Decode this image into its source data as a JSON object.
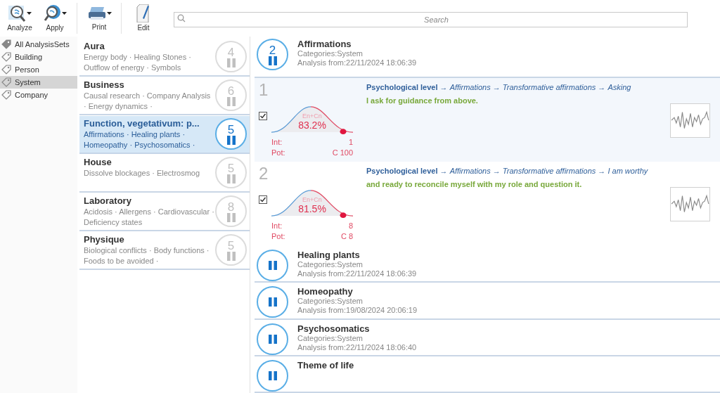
{
  "toolbar": {
    "buttons": [
      {
        "kind": "analyze",
        "label": "Analyze",
        "has_menu": true
      },
      {
        "kind": "apply",
        "label": "Apply",
        "has_menu": true
      },
      {
        "kind": "print",
        "label": "Print",
        "has_menu": true
      },
      {
        "kind": "edit",
        "label": "Edit",
        "has_menu": false
      }
    ]
  },
  "search": {
    "placeholder": "Search"
  },
  "sidebar": {
    "items": [
      {
        "kind": "all",
        "label": "All AnalysisSets",
        "selected": false
      },
      {
        "kind": "tag",
        "label": "Building",
        "selected": false
      },
      {
        "kind": "tag",
        "label": "Person",
        "selected": false
      },
      {
        "kind": "tag",
        "label": "System",
        "selected": true
      },
      {
        "kind": "tag",
        "label": "Company",
        "selected": false
      }
    ]
  },
  "sets": [
    {
      "title": "Aura",
      "tags": "Energy body · Healing Stones · Outflow of energy · Symbols",
      "count": "4",
      "selected": false
    },
    {
      "title": "Business",
      "tags": "Causal research · Company Analysis · Energy dynamics ·",
      "count": "6",
      "selected": false
    },
    {
      "title": "Function, vegetativum: p...",
      "tags": "Affirmations · Healing plants · Homeopathy · Psychosomatics ·",
      "count": "5",
      "selected": true
    },
    {
      "title": "House",
      "tags": "Dissolve blockages · Electrosmog",
      "count": "5",
      "selected": false
    },
    {
      "title": "Laboratory",
      "tags": "Acidosis · Allergens · Cardiovascular · Deficiency states",
      "count": "8",
      "selected": false
    },
    {
      "title": "Physique",
      "tags": "Biological conflicts · Body functions · Foods to be avoided ·",
      "count": "5",
      "selected": false
    }
  ],
  "detail": {
    "header": {
      "count": "2",
      "title": "Affirmations",
      "categories": "Categories:System",
      "analysis": "Analysis from:22/11/2024 18:06:39"
    },
    "results": [
      {
        "number": "1",
        "selected": true,
        "checked": true,
        "chart_label": "En+Cn",
        "percent": "83.2%",
        "int_label": "Int:",
        "int_value": "1",
        "pot_label": "Pot:",
        "pot_value": "C 100",
        "path": [
          "Psychological level",
          "Affirmations",
          "Transformative affirmations",
          "Asking"
        ],
        "separator": "→",
        "text": "I ask for guidance from above."
      },
      {
        "number": "2",
        "selected": false,
        "checked": true,
        "chart_label": "En+Cn",
        "percent": "81.5%",
        "int_label": "Int:",
        "int_value": "8",
        "pot_label": "Pot:",
        "pot_value": "C 8",
        "path": [
          "Psychological level",
          "Affirmations",
          "Transformative affirmations",
          "I am worthy"
        ],
        "separator": "→",
        "text": "and ready to reconcile myself with my role and question it."
      }
    ],
    "entries": [
      {
        "title": "Healing plants",
        "categories": "Categories:System",
        "analysis": "Analysis from:22/11/2024 18:06:39"
      },
      {
        "title": "Homeopathy",
        "categories": "Categories:System",
        "analysis": "Analysis from:19/08/2024 20:06:19"
      },
      {
        "title": "Psychosomatics",
        "categories": "Categories:System",
        "analysis": "Analysis from:22/11/2024 18:06:40"
      },
      {
        "title": "Theme of life"
      }
    ]
  }
}
